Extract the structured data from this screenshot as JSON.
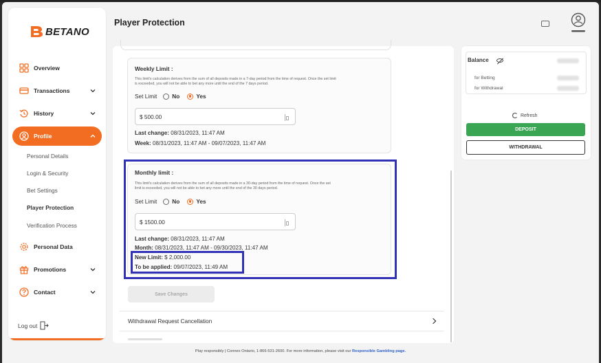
{
  "brand": {
    "name": "BETANO"
  },
  "header": {
    "title": "Player Protection"
  },
  "sidebar": {
    "items": [
      {
        "label": "Overview"
      },
      {
        "label": "Transactions"
      },
      {
        "label": "History"
      },
      {
        "label": "Profile"
      },
      {
        "label": "Personal Data"
      },
      {
        "label": "Promotions"
      },
      {
        "label": "Contact"
      }
    ],
    "profile_sub": [
      {
        "label": "Personal Details"
      },
      {
        "label": "Login & Security"
      },
      {
        "label": "Bet Settings"
      },
      {
        "label": "Player Protection"
      },
      {
        "label": "Verification Process"
      }
    ],
    "logout": "Log out"
  },
  "weekly": {
    "title": "Weekly Limit :",
    "desc1": "This limit's calculation derives from the sum of all deposits made in a 7-day period from the time of request. Once the set limit",
    "desc2": "is exceeded, you will not be able to bet any more until the end of the 7 days period.",
    "set_limit": "Set Limit",
    "no": "No",
    "yes": "Yes",
    "value": "$ 500.00",
    "last_change_label": "Last change:",
    "last_change": "08/31/2023, 11:47 AM",
    "period_label": "Week:",
    "period": "08/31/2023, 11:47 AM - 09/07/2023, 11:47 AM"
  },
  "monthly": {
    "title": "Monthly limit :",
    "desc1": "This limit's calculation derives from the sum of all deposits made in a 30-day period from the time of request. Once the set",
    "desc2": "limit is exceeded, you will not be able to bet any more until the end of the 30 days period.",
    "set_limit": "Set Limit",
    "no": "No",
    "yes": "Yes",
    "value": "$ 1500.00",
    "last_change_label": "Last change:",
    "last_change": "08/31/2023, 11:47 AM",
    "period_label": "Month:",
    "period": "08/31/2023, 11:47 AM - 09/30/2023, 11:47 AM",
    "new_limit_label": "New Limit:",
    "new_limit": "$ 2,000.00",
    "applied_label": "To be applied:",
    "applied": "09/07/2023, 11:49 AM"
  },
  "save_label": "Save Changes",
  "withdrawal_cancel": "Withdrawal Request Cancellation",
  "balance": {
    "title": "Balance",
    "for_betting": "for Betting",
    "for_withdrawal": "for Withdrawal",
    "refresh": "Refresh",
    "deposit": "DEPOSIT",
    "withdrawal": "WITHDRAWAL"
  },
  "footer": {
    "text": "Play responsibly | Connex Ontario, 1-866-531-2600. For more information, please visit our ",
    "link": "Responsible Gambling page."
  },
  "colors": {
    "accent": "#f26c21",
    "deposit": "#3aa553",
    "highlight": "#3131b5"
  }
}
